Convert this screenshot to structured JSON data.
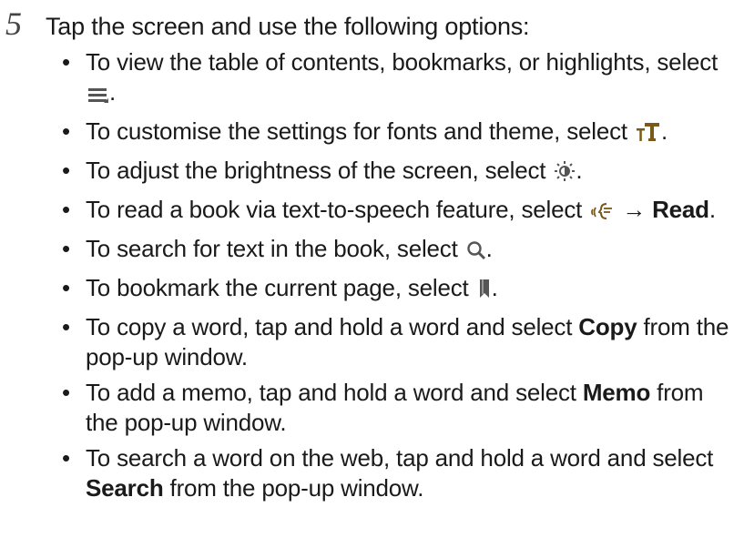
{
  "step": {
    "number": "5",
    "intro": "Tap the screen and use the following options:"
  },
  "options": [
    {
      "pre": "To view the table of contents, bookmarks, or highlights, select ",
      "icon": "list-menu-icon",
      "post": "."
    },
    {
      "pre": "To customise the settings for fonts and theme, select ",
      "icon": "font-settings-icon",
      "post": "."
    },
    {
      "pre": "To adjust the brightness of the screen, select ",
      "icon": "brightness-icon",
      "post": "."
    },
    {
      "pre": "To read a book via text-to-speech feature, select ",
      "icon": "text-to-speech-icon",
      "arrow": " → ",
      "bold": "Read",
      "post": "."
    },
    {
      "pre": "To search for text in the book, select ",
      "icon": "search-icon",
      "post": "."
    },
    {
      "pre": "To bookmark the current page, select ",
      "icon": "bookmark-icon",
      "post": "."
    },
    {
      "pre": "To copy a word, tap and hold a word and select ",
      "bold": "Copy",
      "post": " from the pop-up window."
    },
    {
      "pre": "To add a memo, tap and hold a word and select ",
      "bold": "Memo",
      "post": " from the pop-up window."
    },
    {
      "pre": "To search a word on the web, tap and hold a word and select ",
      "bold": "Search",
      "post": " from the pop-up window."
    }
  ],
  "bullet": "•"
}
